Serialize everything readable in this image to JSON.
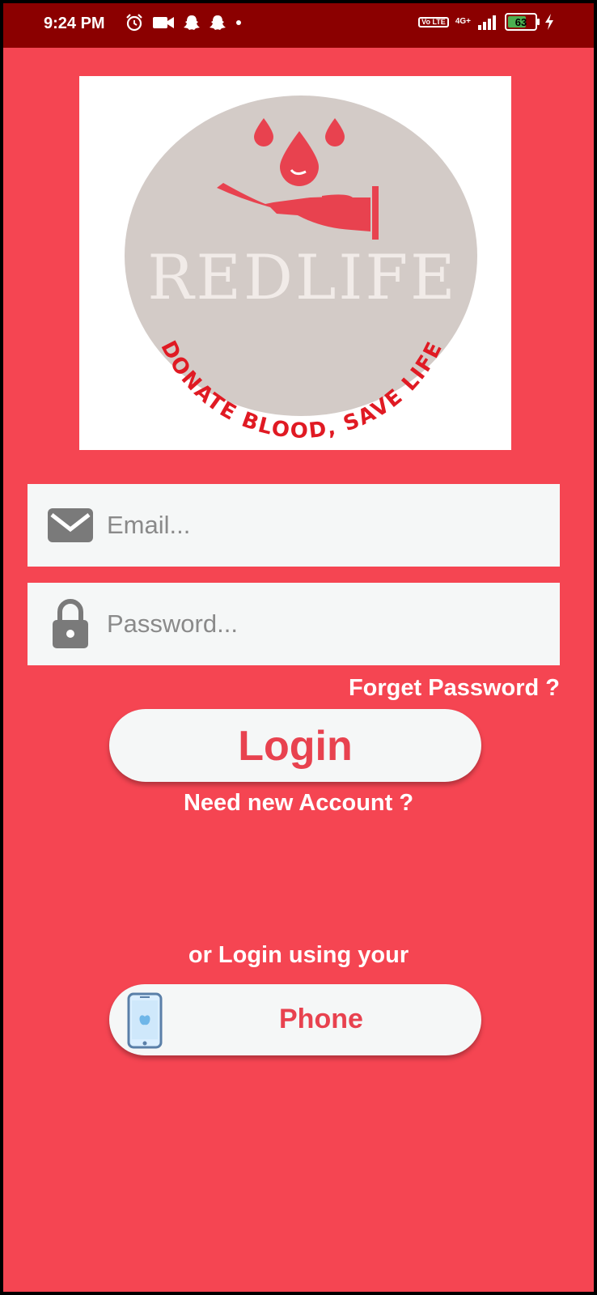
{
  "status_bar": {
    "time": "9:24 PM",
    "lte_label": "Vo LTE",
    "network_label": "4G+",
    "battery_level": "63"
  },
  "logo": {
    "brand_name": "REDLIFE",
    "tagline": "DONATE BLOOD, SAVE LIFE"
  },
  "login_form": {
    "email_placeholder": "Email...",
    "password_placeholder": "Password...",
    "forget_password_label": "Forget Password ?",
    "login_button_label": "Login",
    "need_account_label": "Need new Account ?",
    "alt_login_prompt": "or Login using your",
    "phone_button_label": "Phone"
  },
  "colors": {
    "background": "#f54552",
    "status_bar": "#8b0000",
    "accent": "#e8424f",
    "input_bg": "#f5f7f7",
    "logo_circle": "#d3cbc7"
  }
}
